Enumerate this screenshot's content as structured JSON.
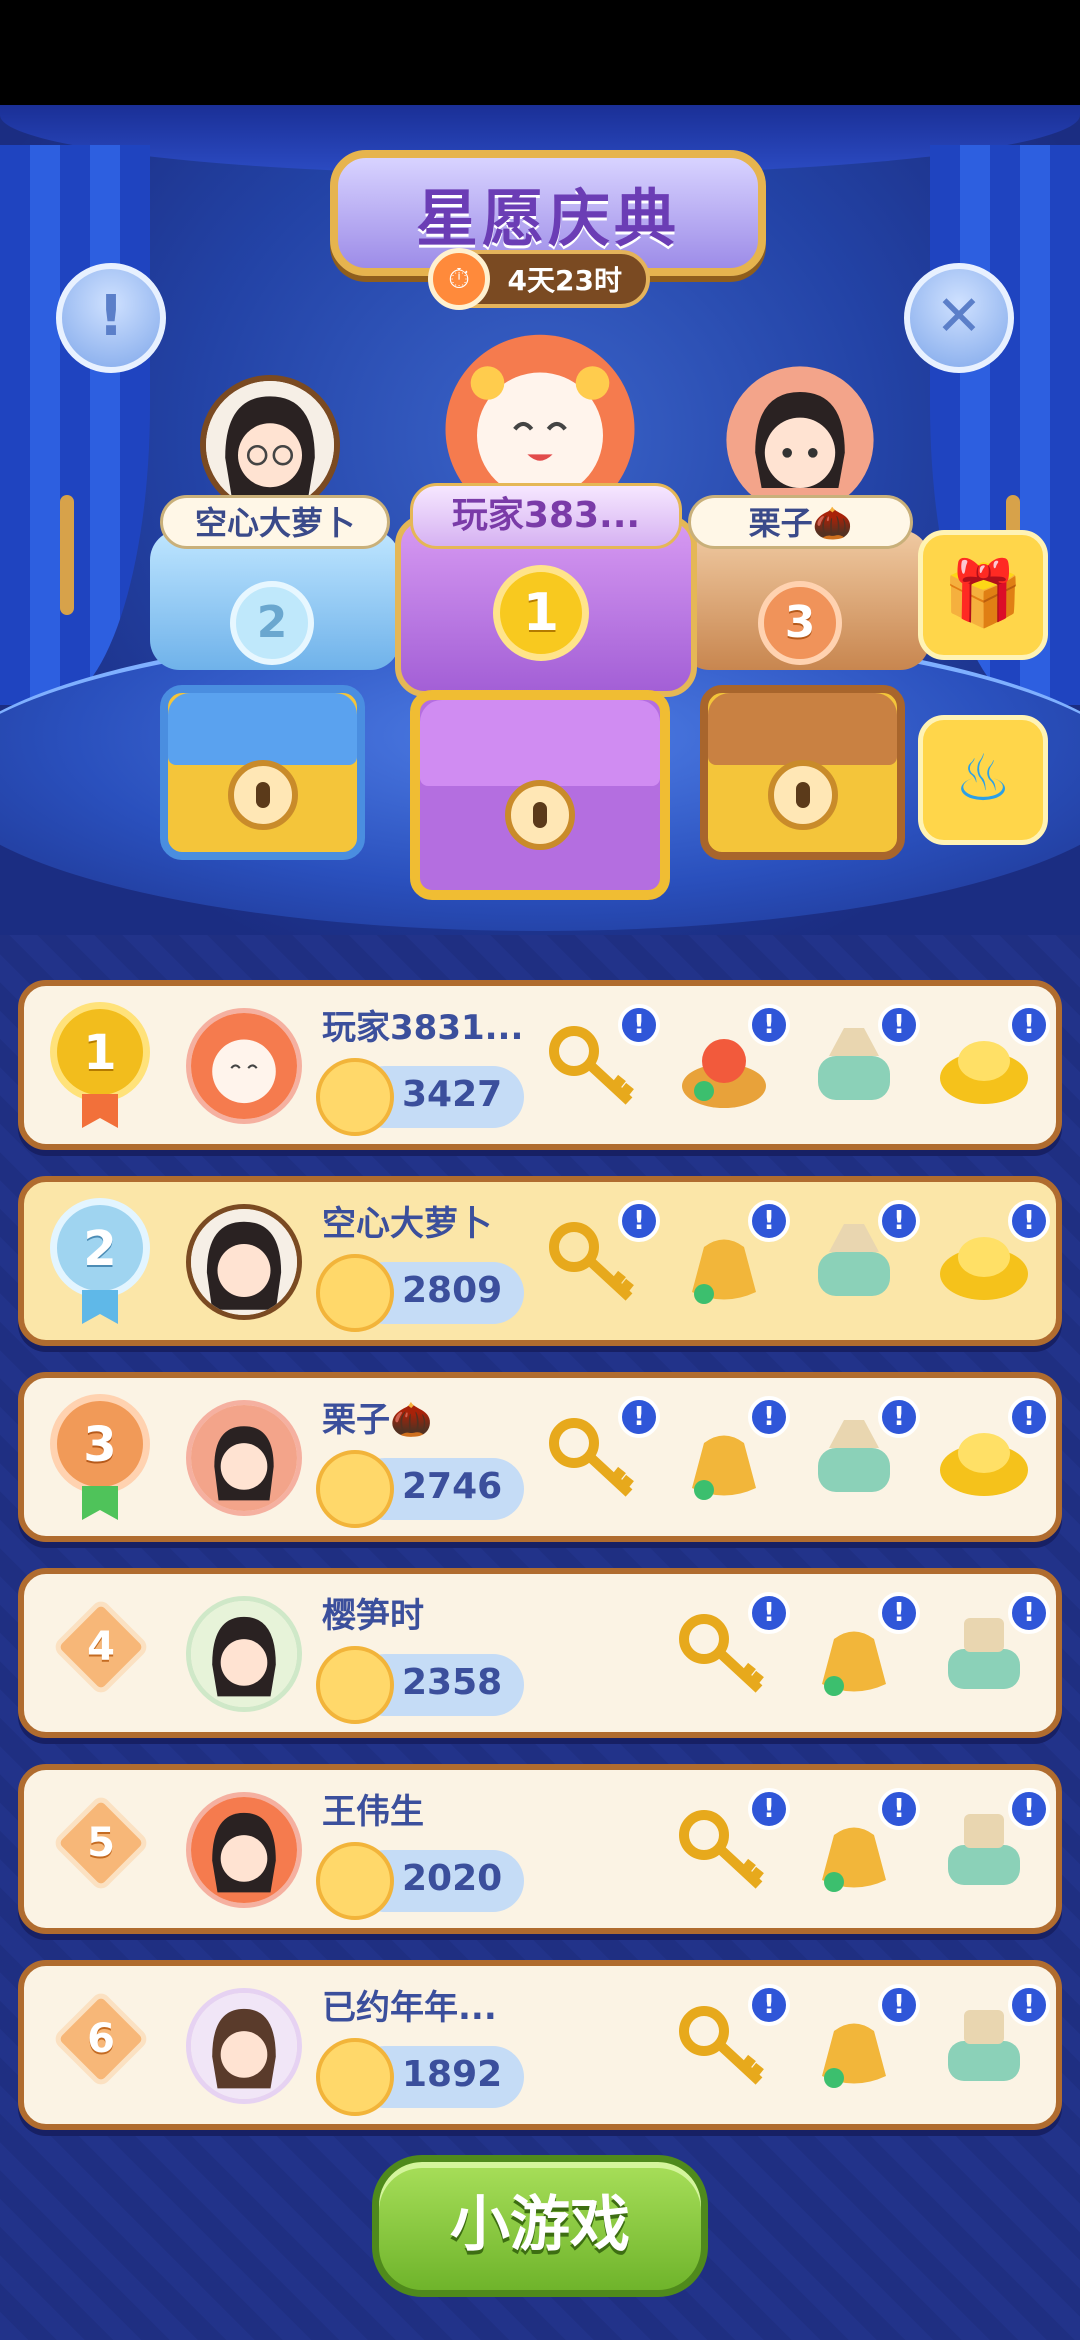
{
  "event": {
    "title": "星愿庆典",
    "timer": "4天23时"
  },
  "podium": [
    {
      "rank": "1",
      "name": "玩家383..."
    },
    {
      "rank": "2",
      "name": "空心大萝卜"
    },
    {
      "rank": "3",
      "name": "栗子🌰"
    }
  ],
  "ranking": [
    {
      "rank": "1",
      "name": "玩家3831...",
      "score": "3427",
      "rewards": [
        "golden-key",
        "treasure-pile",
        "jade-pot",
        "gold-ingot"
      ]
    },
    {
      "rank": "2",
      "name": "空心大萝卜",
      "score": "2809",
      "rewards": [
        "golden-key",
        "money-bag",
        "jade-pot",
        "gold-ingot"
      ]
    },
    {
      "rank": "3",
      "name": "栗子🌰",
      "score": "2746",
      "rewards": [
        "golden-key",
        "money-bag",
        "jade-pot",
        "gold-ingot"
      ]
    },
    {
      "rank": "4",
      "name": "樱笋时",
      "score": "2358",
      "rewards": [
        "golden-key",
        "money-bag",
        "scroll-pot"
      ]
    },
    {
      "rank": "5",
      "name": "王伟生",
      "score": "2020",
      "rewards": [
        "golden-key",
        "money-bag",
        "scroll-pot"
      ]
    },
    {
      "rank": "6",
      "name": "已约年年...",
      "score": "1892",
      "rewards": [
        "golden-key",
        "money-bag",
        "scroll-pot"
      ]
    }
  ],
  "buttons": {
    "info_glyph": "!",
    "close_glyph": "✕",
    "alert_glyph": "!",
    "minigame": "小游戏"
  },
  "colors": {
    "gold": "#f2bd1d",
    "silver": "#9fd4f0",
    "bronze": "#f19a58",
    "accent_blue": "#2f56d8",
    "button_green": "#6fb42b"
  }
}
